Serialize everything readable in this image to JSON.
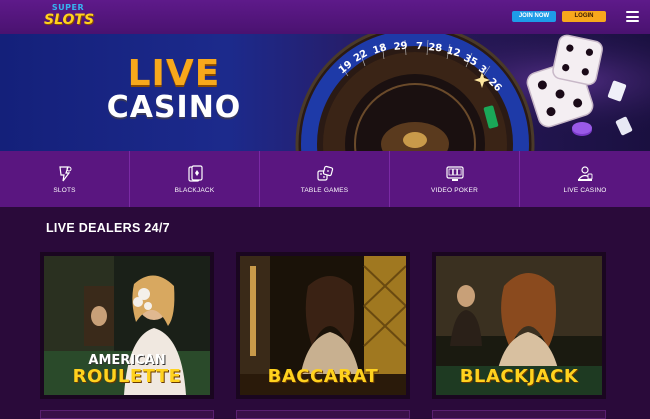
{
  "header": {
    "logo_line1": "SUPER",
    "logo_line2": "SLOTS",
    "join_label": "JOIN NOW",
    "login_label": "LOGIN",
    "menu_icon": "hamburger-menu-icon"
  },
  "banner": {
    "line1": "LIVE",
    "line2": "CASINO",
    "wheel_numbers": [
      "19",
      "22",
      "18",
      "29",
      "7",
      "28",
      "12",
      "35",
      "3",
      "26"
    ]
  },
  "categories": [
    {
      "label": "SLOTS",
      "icon": "slots-icon"
    },
    {
      "label": "BLACKJACK",
      "icon": "cards-icon"
    },
    {
      "label": "TABLE GAMES",
      "icon": "table-dice-icon"
    },
    {
      "label": "VIDEO POKER",
      "icon": "video-poker-icon"
    },
    {
      "label": "LIVE CASINO",
      "icon": "live-dealer-icon"
    }
  ],
  "section": {
    "title": "LIVE DEALERS 24/7"
  },
  "cards": [
    {
      "subtitle": "AMERICAN",
      "title": "ROULETTE"
    },
    {
      "subtitle": "",
      "title": "BACCARAT"
    },
    {
      "subtitle": "",
      "title": "BLACKJACK"
    }
  ],
  "colors": {
    "header_bg": "#5e1a8a",
    "page_bg": "#2a0a3a",
    "nav_bg": "#5a1680",
    "join_button": "#1e9ce8",
    "login_button": "#f7a81c",
    "title_gold": "#ffd21e",
    "live_orange": "#f7a81c"
  }
}
